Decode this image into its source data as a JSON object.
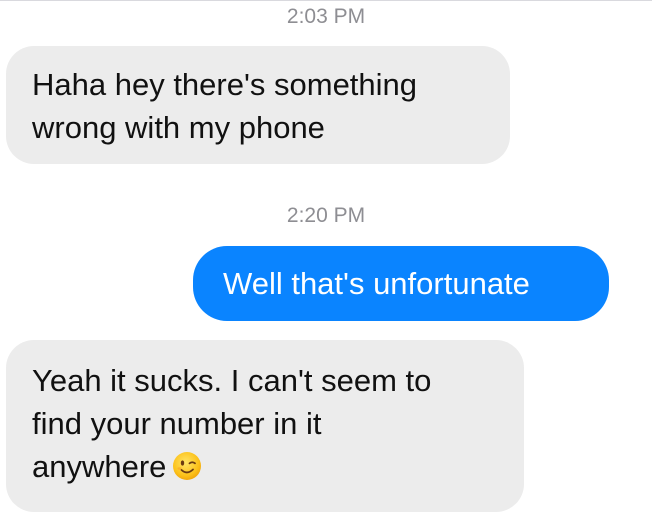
{
  "conversation": {
    "timestamps": [
      "2:03 PM",
      "2:20 PM"
    ],
    "messages": [
      {
        "direction": "received",
        "lines": [
          "Haha hey there's something",
          "wrong with my phone"
        ]
      },
      {
        "direction": "sent",
        "lines": [
          "Well that's unfortunate"
        ]
      },
      {
        "direction": "received",
        "lines": [
          "Yeah it sucks. I can't seem to",
          "find your number in it",
          "anywhere"
        ],
        "trailing_emoji": "winking-face-emoji"
      }
    ]
  },
  "colors": {
    "sent_bubble": "#0a84ff",
    "received_bubble": "#ececec",
    "timestamp_text": "#8e8e93"
  }
}
